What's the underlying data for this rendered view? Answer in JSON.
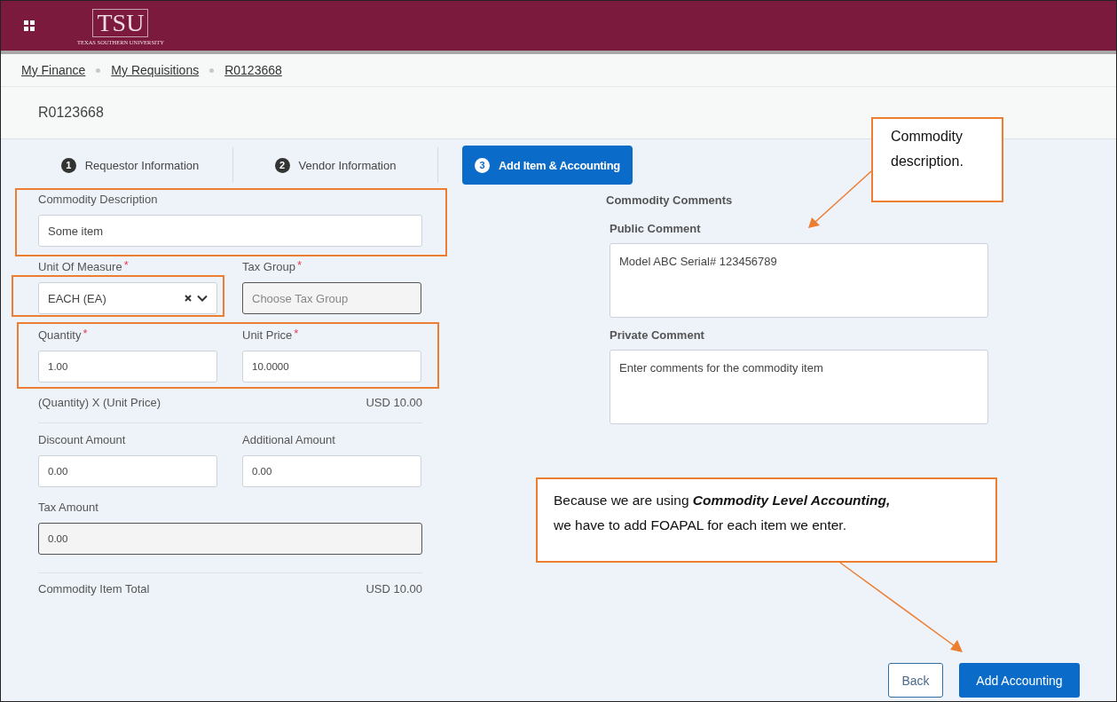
{
  "header": {
    "logo": "TSU",
    "university": "TEXAS SOUTHERN UNIVERSITY"
  },
  "breadcrumbs": [
    "My Finance",
    "My Requisitions",
    "R0123668"
  ],
  "page_title": "R0123668",
  "steps": [
    {
      "number": "1",
      "label": "Requestor Information",
      "selected": false
    },
    {
      "number": "2",
      "label": "Vendor Information",
      "selected": false
    },
    {
      "number": "3",
      "label": "Add Item & Accounting",
      "selected": true
    }
  ],
  "commodity_description": {
    "label": "Commodity Description",
    "value": "Some item"
  },
  "unit_of_measure": {
    "label": "Unit Of Measure",
    "required_mark": "*",
    "value": "EACH (EA)"
  },
  "tax_group": {
    "label": "Tax Group",
    "required_mark": "*",
    "placeholder": "Choose Tax Group",
    "disabled": true
  },
  "quantity": {
    "label": "Quantity",
    "required_mark": "*",
    "value": "1.00"
  },
  "unit_price": {
    "label": "Unit Price",
    "required_mark": "*",
    "value": "10.0000"
  },
  "extended": {
    "label": "(Quantity) X (Unit Price)",
    "amount": "USD 10.00"
  },
  "discount_amount": {
    "label": "Discount Amount",
    "value": "0.00",
    "disabled": false
  },
  "additional_amount": {
    "label": "Additional Amount",
    "value": "0.00",
    "disabled": false
  },
  "tax_amount": {
    "label": "Tax Amount",
    "value": "0.00",
    "disabled": true
  },
  "item_total": {
    "label": "Commodity Item Total",
    "amount": "USD 10.00"
  },
  "comments": {
    "heading": "Commodity Comments",
    "public_label": "Public Comment",
    "public_value": "Model ABC Serial# 123456789",
    "private_label": "Private Comment",
    "private_placeholder": "Enter comments for the commodity item"
  },
  "buttons": {
    "back": "Back",
    "add_accounting": "Add Accounting"
  },
  "callouts": [
    {
      "text": "Commodity description."
    },
    {
      "text": "Because we are using **Commodity Level Accounting,**\nwe have to add FOAPAL for each item we enter."
    }
  ]
}
